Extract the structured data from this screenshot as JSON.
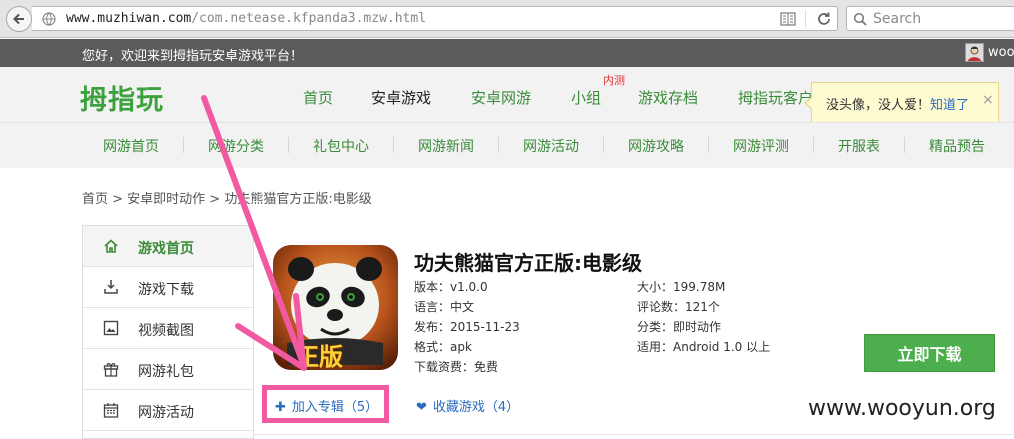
{
  "browser": {
    "url_host": "www.muzhiwan.com",
    "url_path": "/com.netease.kfpanda3.mzw.html",
    "search_placeholder": "Search"
  },
  "top_strip": {
    "welcome": "您好，欢迎来到拇指玩安卓游戏平台！",
    "user": "wooy"
  },
  "header": {
    "logo": "拇指玩",
    "nav": [
      {
        "label": "首页"
      },
      {
        "label": "安卓游戏"
      },
      {
        "label": "安卓网游"
      },
      {
        "label": "小组"
      },
      {
        "label": "游戏存档"
      },
      {
        "label": "拇指玩客户"
      }
    ],
    "nav_badge": "内测"
  },
  "tooltip": {
    "text": "没头像，没人爱！",
    "link": "知道了",
    "close": "×"
  },
  "sub_nav": [
    {
      "label": "网游首页"
    },
    {
      "label": "网游分类"
    },
    {
      "label": "礼包中心"
    },
    {
      "label": "网游新闻"
    },
    {
      "label": "网游活动"
    },
    {
      "label": "网游攻略"
    },
    {
      "label": "网游评测"
    },
    {
      "label": "开服表"
    },
    {
      "label": "精品预告"
    }
  ],
  "breadcrumb": "首页 > 安卓即时动作 > 功夫熊猫官方正版:电影级",
  "sidebar": [
    {
      "label": "游戏首页",
      "icon": "home-icon"
    },
    {
      "label": "游戏下载",
      "icon": "download-icon"
    },
    {
      "label": "视频截图",
      "icon": "image-icon"
    },
    {
      "label": "网游礼包",
      "icon": "gift-icon"
    },
    {
      "label": "网游活动",
      "icon": "calendar-icon"
    }
  ],
  "game": {
    "icon_badge": "正版",
    "title": "功夫熊猫官方正版:电影级",
    "info_left": [
      "版本：v1.0.0",
      "语言：中文",
      "发布：2015-11-23",
      "格式：apk",
      "下载资费：免费"
    ],
    "info_right": [
      "大小：199.78M",
      "评论数：121个",
      "分类：即时动作",
      "适用：Android 1.0 以上"
    ],
    "download_label": "立即下载",
    "add_topic": "加入专辑（5）",
    "add_topic_icon": "✚",
    "favorite": "收藏游戏（4）",
    "favorite_icon": "❤"
  },
  "watermark": "www.wooyun.org",
  "colors": {
    "brand_green": "#3da23d",
    "link_blue": "#2a6cc0",
    "highlight_pink": "#f15aa0"
  }
}
